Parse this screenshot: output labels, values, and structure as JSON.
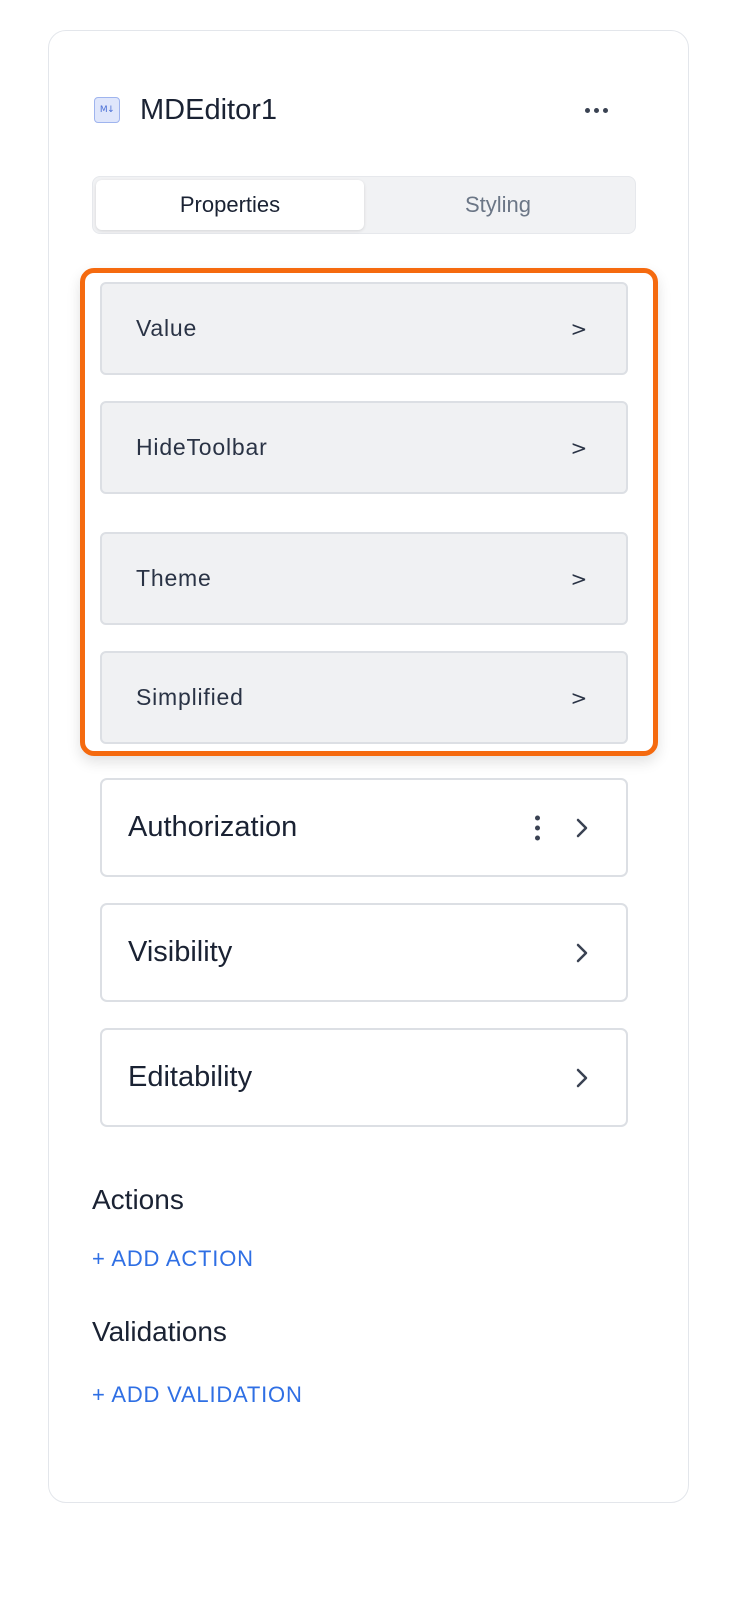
{
  "component": {
    "icon": "markdown-icon",
    "icon_glyph": "M↓",
    "name": "MDEditor1",
    "menu_icon": "more-horizontal-icon"
  },
  "tabs": [
    {
      "label": "Properties",
      "active": true
    },
    {
      "label": "Styling",
      "active": false
    }
  ],
  "properties": [
    {
      "label": "Value"
    },
    {
      "label": "HideToolbar"
    },
    {
      "label": "Theme"
    },
    {
      "label": "Simplified"
    }
  ],
  "sections": [
    {
      "label": "Authorization",
      "has_menu": true
    },
    {
      "label": "Visibility",
      "has_menu": false
    },
    {
      "label": "Editability",
      "has_menu": false
    }
  ],
  "actions": {
    "heading": "Actions",
    "add_label": "+ ADD ACTION"
  },
  "validations": {
    "heading": "Validations",
    "add_label": "+ ADD VALIDATION"
  },
  "colors": {
    "highlight": "#f56a0f",
    "link": "#2f6fe4",
    "text": "#1a2233"
  }
}
